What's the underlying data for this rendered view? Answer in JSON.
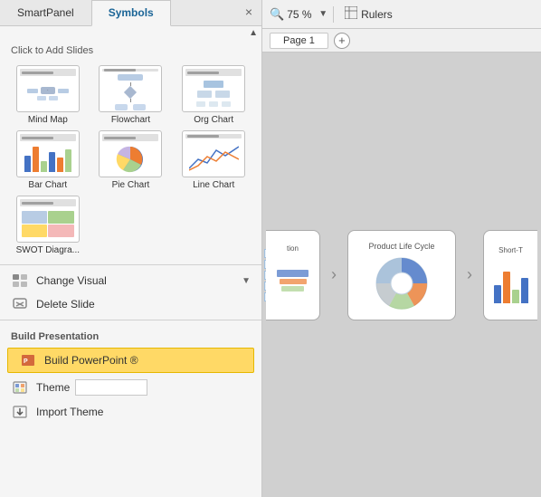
{
  "panel": {
    "tab1": "SmartPanel",
    "tab2": "Symbols",
    "close": "×",
    "section_title": "Click to Add Slides",
    "slides": [
      {
        "label": "Mind Map",
        "type": "mindmap"
      },
      {
        "label": "Flowchart",
        "type": "flowchart"
      },
      {
        "label": "Org Chart",
        "type": "orgchart"
      },
      {
        "label": "Bar Chart",
        "type": "barchart"
      },
      {
        "label": "Pie Chart",
        "type": "piechart"
      },
      {
        "label": "Line Chart",
        "type": "linechart"
      },
      {
        "label": "SWOT Diagra...",
        "type": "swot"
      }
    ],
    "menu": {
      "change_visual": "Change Visual",
      "delete_slide": "Delete Slide"
    },
    "build_section": "Build Presentation",
    "build_powerpoint": "Build PowerPoint ®",
    "theme": "Theme",
    "import_theme": "Import Theme"
  },
  "toolbar": {
    "zoom_icon": "🔍",
    "zoom_value": "75 %",
    "zoom_dropdown": "▼",
    "rulers_icon": "⊞",
    "rulers_label": "Rulers"
  },
  "pages": {
    "page1_label": "Page 1",
    "add_icon": "+"
  },
  "canvas": {
    "node1_label": "tion",
    "node2_label": "Product Life Cycle",
    "node3_label": "Short-T"
  },
  "colors": {
    "accent_blue": "#4472c4",
    "highlight_yellow": "#ffd966",
    "border_yellow": "#e6b800"
  }
}
